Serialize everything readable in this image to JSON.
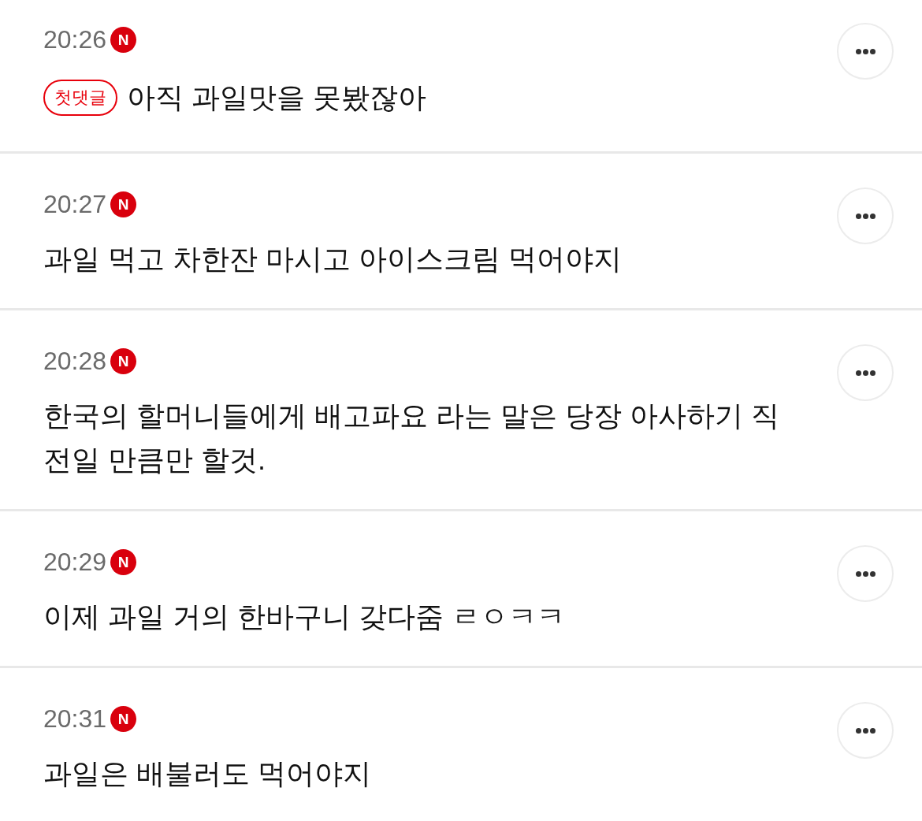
{
  "comments": [
    {
      "time": "20:26",
      "badge": "N",
      "tag": "첫댓글",
      "text": "아직 과일맛을 못봤잖아"
    },
    {
      "time": "20:27",
      "badge": "N",
      "text": "과일 먹고 차한잔 마시고 아이스크림 먹어야지"
    },
    {
      "time": "20:28",
      "badge": "N",
      "text": "한국의 할머니들에게 배고파요 라는 말은 당장 아사하기 직전일 만큼만 할것."
    },
    {
      "time": "20:29",
      "badge": "N",
      "text": "이제 과일 거의 한바구니 갖다줌 ㄹㅇㅋㅋ"
    },
    {
      "time": "20:31",
      "badge": "N",
      "text": "과일은 배불러도 먹어야지"
    }
  ]
}
